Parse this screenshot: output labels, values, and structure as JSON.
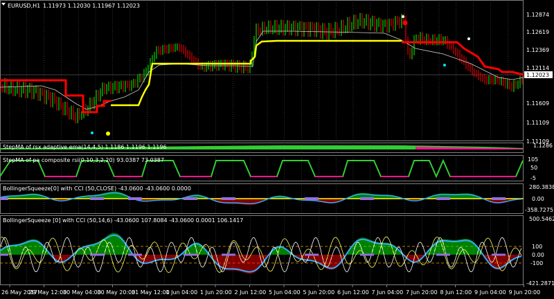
{
  "window": {
    "symbol_title": "EURUSD,H1",
    "ohlc": "1.11973 1.12030 1.11967 1.12023"
  },
  "main_axis": {
    "labels": [
      "1.12874",
      "1.12619",
      "1.12369",
      "1.12114",
      "1.11609",
      "1.11109"
    ],
    "current_price": "1.12023"
  },
  "indicators": {
    "stepma_ema": {
      "title": "StepMA of rsx adaptive ema(14,4,5) 1.1186 1.1196 1.1196",
      "axis_labels": [
        "1.1286",
        "1.11109"
      ]
    },
    "stepma_rsi": {
      "title": "StepMA of pa composite rsi(0,10,3,2,20) 93.0387 73.0387",
      "axis_labels": [
        "105",
        "50",
        "-5"
      ]
    },
    "bb_cci_1": {
      "title": "BollingerSqueeze[0] with CCI (50,CLOSE) -43.0600 -43.0600 0.0000",
      "axis_labels": [
        "280.3838",
        "0.00",
        "-358.7275"
      ]
    },
    "bb_cci_2": {
      "title": "BollingerSqueeze [0] with CCI (50,14,6) -43.0600 107.8084 -43.0600 0.0001 106.1417",
      "axis_labels": [
        "500.5462",
        "100",
        "0.00",
        "-100",
        "-421.2871"
      ]
    }
  },
  "time_axis": {
    "labels": [
      "26 May 2017",
      "29 May 12:00",
      "30 May 04:00",
      "30 May 20:00",
      "31 May 12:00",
      "1 Jun 04:00",
      "1 Jun 20:00",
      "2 Jun 12:00",
      "5 Jun 04:00",
      "5 Jun 20:00",
      "6 Jun 12:00",
      "7 Jun 04:00",
      "7 Jun 20:00",
      "8 Jun 12:00",
      "9 Jun 04:00",
      "9 Jun 20:00"
    ]
  },
  "colors": {
    "bull_bar": "#00ff00",
    "bear_bar": "#ff0000",
    "step_red": "#ff0000",
    "step_yellow": "#ffff00",
    "step_green": "#32cd32",
    "step_magenta": "#ff1493",
    "cci_blue": "#33aaff",
    "squeeze_purple": "#9370db",
    "level_line": "#ffa500"
  }
}
